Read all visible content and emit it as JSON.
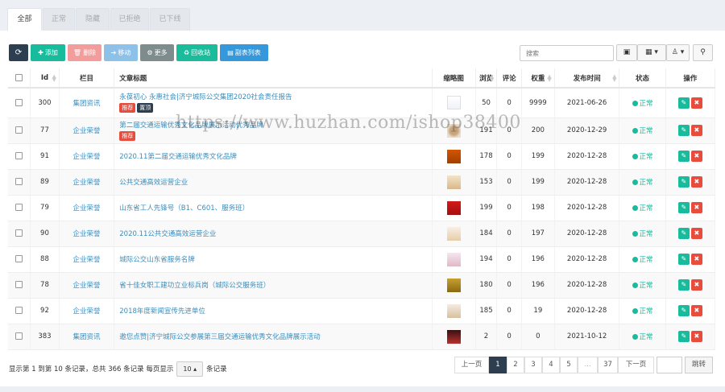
{
  "tabs": [
    "全部",
    "正常",
    "隐藏",
    "已拒绝",
    "已下线"
  ],
  "toolbar": {
    "refresh_icon": "refresh-icon",
    "add": "添加",
    "delete": "删除",
    "move": "移动",
    "more": "更多",
    "recycle": "回收站",
    "sub_list": "副表列表"
  },
  "search": {
    "placeholder": "搜索"
  },
  "columns": {
    "id": "Id",
    "column": "栏目",
    "title": "文章标题",
    "thumb": "缩略图",
    "views": "浏览",
    "comments": "评论",
    "weight": "权重",
    "publish_time": "发布时间",
    "status": "状态",
    "actions": "操作"
  },
  "rows": [
    {
      "id": "300",
      "column": "集团资讯",
      "title": "永葆初心 永惠社会|济宁城际公交集团2020社会责任报告",
      "flags": [
        "推荐",
        "置顶"
      ],
      "views": "50",
      "comments": "0",
      "weight": "9999",
      "date": "2021-06-26",
      "status": "正常"
    },
    {
      "id": "77",
      "column": "企业荣誉",
      "title": "第二届交通运输优秀文化品牌展示活动优秀品牌",
      "flags": [
        "推荐"
      ],
      "views": "191",
      "comments": "0",
      "weight": "200",
      "date": "2020-12-29",
      "status": "正常"
    },
    {
      "id": "91",
      "column": "企业荣誉",
      "title": "2020.11第二届交通运输优秀文化品牌",
      "flags": [],
      "views": "178",
      "comments": "0",
      "weight": "199",
      "date": "2020-12-28",
      "status": "正常"
    },
    {
      "id": "89",
      "column": "企业荣誉",
      "title": "公共交通高效运营企业",
      "flags": [],
      "views": "153",
      "comments": "0",
      "weight": "199",
      "date": "2020-12-28",
      "status": "正常"
    },
    {
      "id": "79",
      "column": "企业荣誉",
      "title": "山东省工人先锋号（B1、C601、服务班）",
      "flags": [],
      "views": "199",
      "comments": "0",
      "weight": "198",
      "date": "2020-12-28",
      "status": "正常"
    },
    {
      "id": "90",
      "column": "企业荣誉",
      "title": "2020.11公共交通高效运营企业",
      "flags": [],
      "views": "184",
      "comments": "0",
      "weight": "197",
      "date": "2020-12-28",
      "status": "正常"
    },
    {
      "id": "88",
      "column": "企业荣誉",
      "title": "城际公交山东省服务名牌",
      "flags": [],
      "views": "194",
      "comments": "0",
      "weight": "196",
      "date": "2020-12-28",
      "status": "正常"
    },
    {
      "id": "78",
      "column": "企业荣誉",
      "title": "省十佳女职工建功立业标兵岗（城际公交服务班）",
      "flags": [],
      "views": "180",
      "comments": "0",
      "weight": "196",
      "date": "2020-12-28",
      "status": "正常"
    },
    {
      "id": "92",
      "column": "企业荣誉",
      "title": "2018年度新闻宣传先进单位",
      "flags": [],
      "views": "185",
      "comments": "0",
      "weight": "19",
      "date": "2020-12-28",
      "status": "正常"
    },
    {
      "id": "383",
      "column": "集团资讯",
      "title": "邀您点赞|济宁城际公交参展第三届交通运输优秀文化品牌展示活动",
      "flags": [],
      "views": "2",
      "comments": "0",
      "weight": "0",
      "date": "2021-10-12",
      "status": "正常"
    }
  ],
  "footer": {
    "summary": "显示第 1 到第 10 条记录，总共 366 条记录 每页显示",
    "page_size": "10",
    "suffix": "条记录"
  },
  "pagination": {
    "prev": "上一页",
    "pages": [
      "1",
      "2",
      "3",
      "4",
      "5",
      "...",
      "37"
    ],
    "next": "下一页",
    "jump": "跳转"
  },
  "watermark": "https://www.huzhan.com/ishop38400",
  "colors": {
    "dark": "#2c3e50",
    "green": "#18bc9c",
    "red": "#e74c3c",
    "pink": "#f39c9c",
    "blue": "#3c8dbc",
    "azure": "#5dade2",
    "gray": "#95a5a6",
    "teal": "#1abc9c",
    "bright_blue": "#3498db"
  }
}
